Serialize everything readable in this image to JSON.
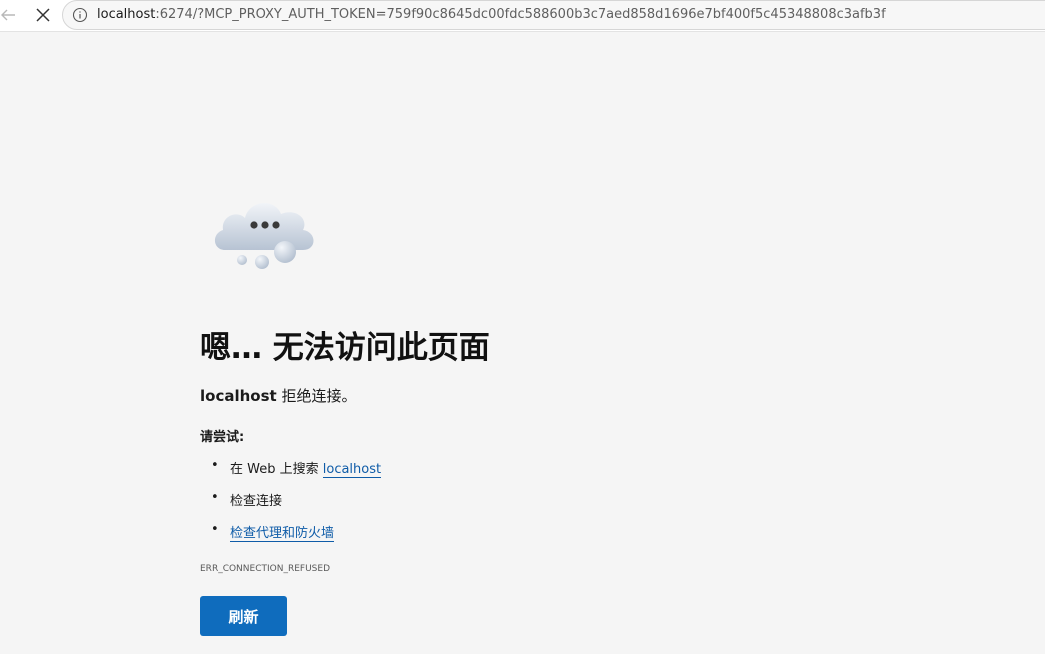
{
  "browser": {
    "url_host": "localhost",
    "url_rest": ":6274/?MCP_PROXY_AUTH_TOKEN=759f90c8645dc00fdc588600b3c7aed858d1696e7bf400f5c45348808c3afb3f",
    "icons": {
      "back": "back-arrow-icon",
      "stop": "close-icon",
      "info": "info-icon"
    }
  },
  "error_page": {
    "illustration": "cloud-icon",
    "heading": "嗯… 无法访问此页面",
    "subtitle_host": "localhost",
    "subtitle_text": " 拒绝连接。",
    "try_label": "请尝试:",
    "suggestions": [
      {
        "bullet": "•",
        "prefix": "在 Web 上搜索 ",
        "link": "localhost"
      },
      {
        "bullet": "•",
        "text": "检查连接"
      },
      {
        "bullet": "•",
        "link": "检查代理和防火墙"
      }
    ],
    "error_code": "ERR_CONNECTION_REFUSED",
    "refresh_label": "刷新",
    "colors": {
      "link": "#0f5ca8",
      "button": "#0f6cbd",
      "background": "#f5f5f5"
    }
  }
}
